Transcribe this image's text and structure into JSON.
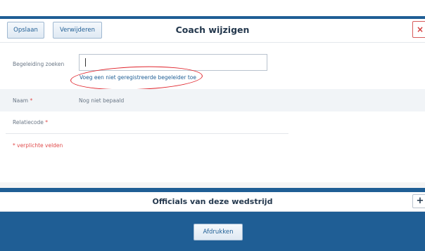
{
  "toolbar": {
    "save_label": "Opslaan",
    "delete_label": "Verwijderen",
    "title": "Coach wijzigen",
    "close_glyph": "×"
  },
  "form": {
    "search_label": "Begeleiding zoeken",
    "search_value": "",
    "add_unregistered_link": "Voeg een niet geregistreerde begeleider toe",
    "name_label": "Naam",
    "name_value": "Nog niet bepaald",
    "relation_label": "Relatiecode",
    "required_marker": "*",
    "required_note": "* verplichte velden"
  },
  "officials": {
    "title": "Officials van deze wedstrijd",
    "add_glyph": "+"
  },
  "footer": {
    "print_label": "Afdrukken"
  },
  "colors": {
    "brand_blue": "#1f5e95",
    "annotation_red": "#e0222a",
    "required_red": "#e04b4b"
  },
  "icons": {
    "close": "close-icon",
    "add": "plus-icon"
  }
}
